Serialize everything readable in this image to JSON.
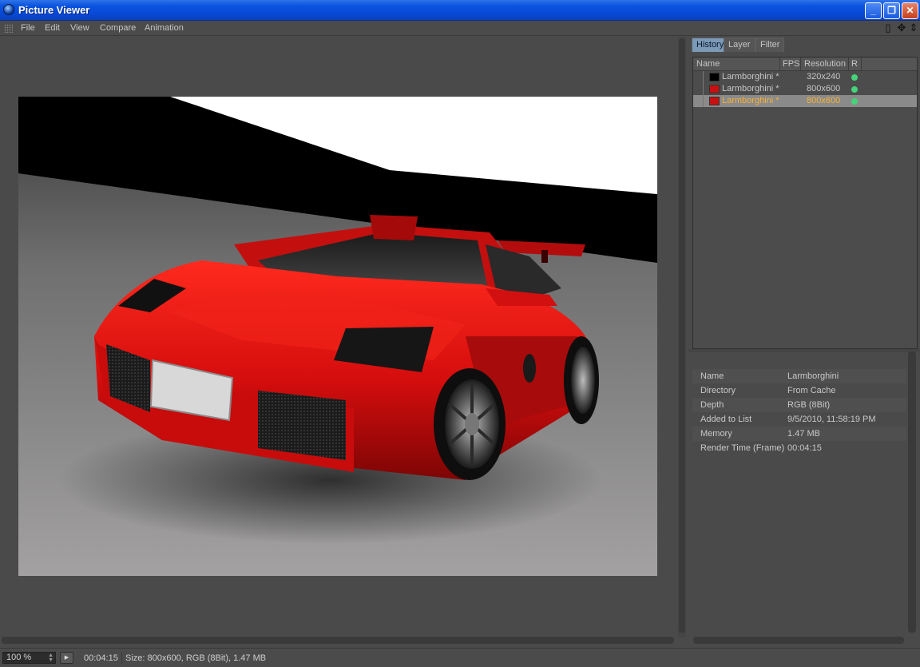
{
  "window": {
    "title": "Picture Viewer"
  },
  "menu": {
    "items": [
      "File",
      "Edit",
      "View",
      "Compare",
      "Animation"
    ]
  },
  "tabs": [
    "History",
    "Layer",
    "Filter"
  ],
  "history": {
    "columns": [
      "Name",
      "FPS",
      "Resolution",
      "R"
    ],
    "rows": [
      {
        "name": "Larmborghini *",
        "fps": "",
        "resolution": "320x240",
        "rendered": true,
        "selected": false
      },
      {
        "name": "Larmborghini *",
        "fps": "",
        "resolution": "800x600",
        "rendered": true,
        "selected": false
      },
      {
        "name": "Larmborghini *",
        "fps": "",
        "resolution": "800x600",
        "rendered": true,
        "selected": true
      }
    ]
  },
  "info": [
    {
      "key": "Name",
      "value": "Larmborghini"
    },
    {
      "key": "Directory",
      "value": "From Cache"
    },
    {
      "key": "Depth",
      "value": "RGB (8Bit)"
    },
    {
      "key": "Added to List",
      "value": "9/5/2010, 11:58:19 PM"
    },
    {
      "key": "Memory",
      "value": "1.47 MB"
    },
    {
      "key": "Render Time (Frame)",
      "value": "00:04:15"
    }
  ],
  "status": {
    "zoom": "100 %",
    "time": "00:04:15",
    "info": "Size: 800x600, RGB (8Bit), 1.47 MB"
  },
  "colors": {
    "selected_text": "#f6b035",
    "render_dot": "#46d37a",
    "tab_active": "#7a9ab8"
  }
}
